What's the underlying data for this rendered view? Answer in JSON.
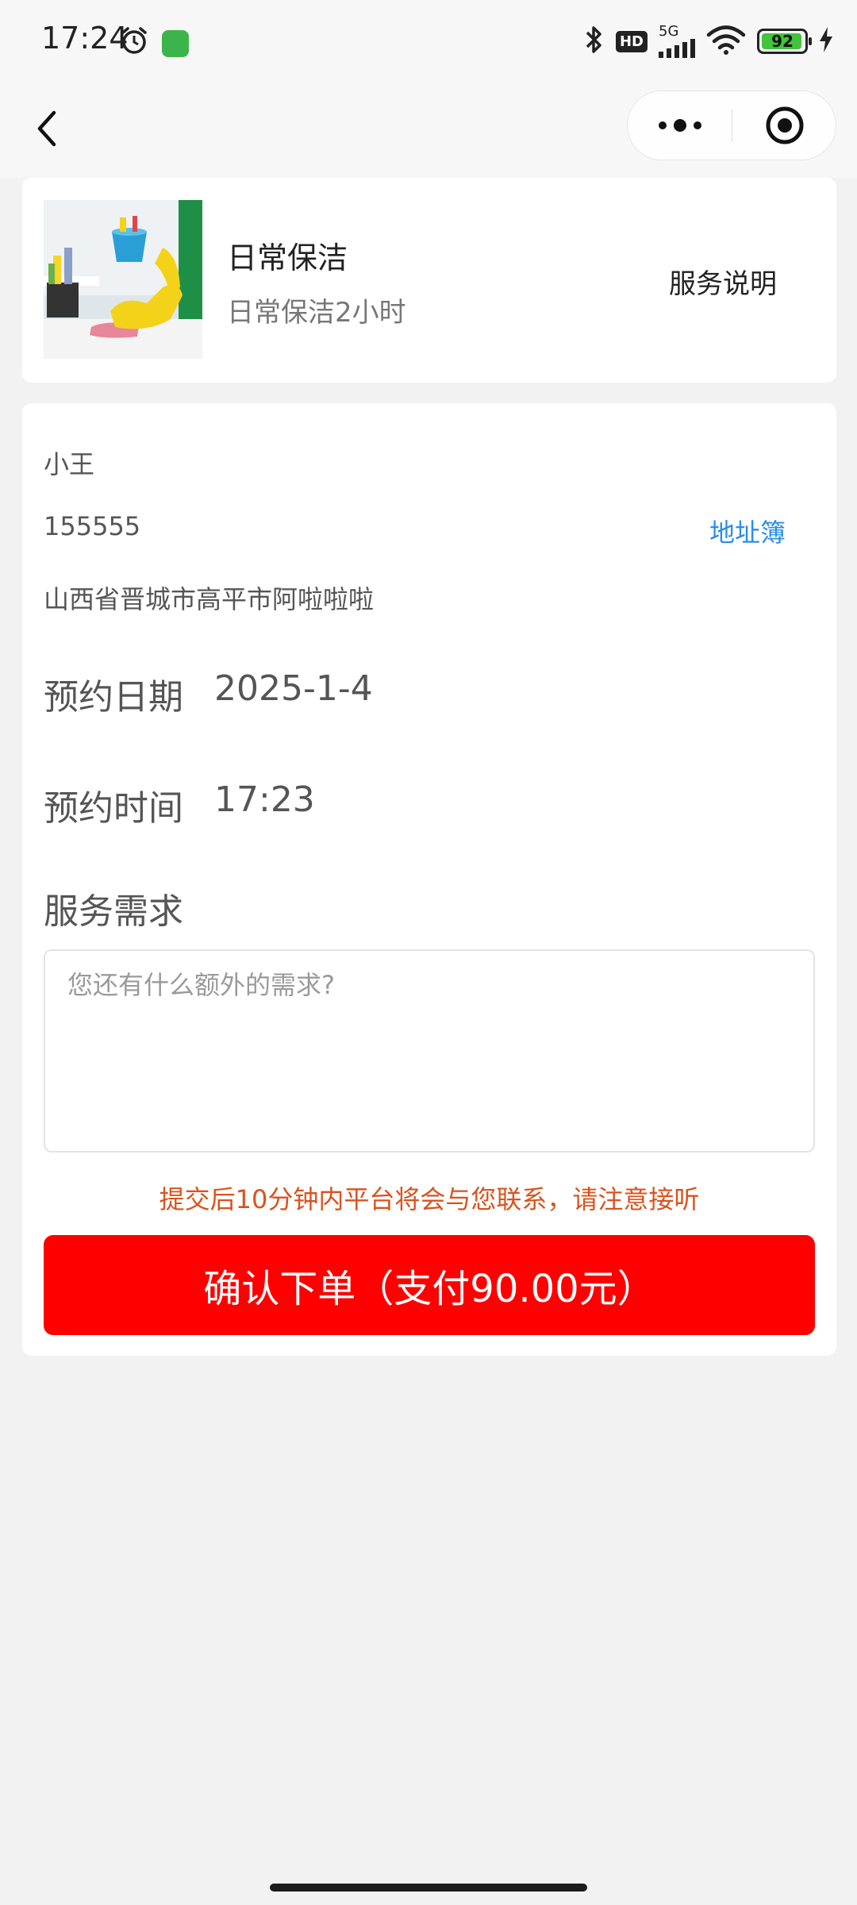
{
  "status_bar": {
    "time": "17:24",
    "battery_level": "92",
    "hd_badge": "HD",
    "network": "5G",
    "icons": [
      "alarm-icon",
      "app-notification-icon",
      "bluetooth-icon",
      "signal-icon",
      "wifi-icon",
      "battery-icon",
      "charging-icon"
    ]
  },
  "nav": {
    "icons": [
      "back-icon",
      "more-icon",
      "target-icon"
    ]
  },
  "service": {
    "name": "日常保洁",
    "subtitle": "日常保洁2小时",
    "explain_label": "服务说明"
  },
  "contact": {
    "name": "小王",
    "phone": "155555",
    "address_book_label": "地址簿",
    "address": "山西省晋城市高平市阿啦啦啦"
  },
  "booking": {
    "date_label": "预约日期",
    "date_value": "2025-1-4",
    "time_label": "预约时间",
    "time_value": "17:23"
  },
  "requirements": {
    "label": "服务需求",
    "placeholder": "您还有什么额外的需求?",
    "value": ""
  },
  "notice": "提交后10分钟内平台将会与您联系，请注意接听",
  "submit": {
    "label": "确认下单（支付90.00元）"
  },
  "colors": {
    "accent_link": "#2b8de6",
    "notice": "#d9531e",
    "submit_bg": "#ff0000",
    "page_bg": "#f2f2f2"
  }
}
